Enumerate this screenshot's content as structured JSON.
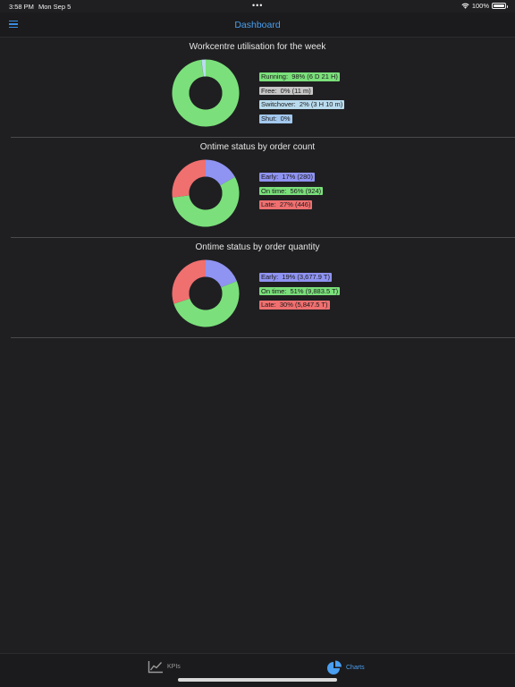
{
  "status_bar": {
    "time": "3:58 PM",
    "date": "Mon Sep 5",
    "dots": "•••",
    "battery": "100%"
  },
  "nav": {
    "title": "Dashboard",
    "accent_color": "#4a9ff0"
  },
  "chart_data": [
    {
      "type": "pie",
      "donut": true,
      "title": "Workcentre utilisation for the week",
      "legend_position": "right",
      "slices": [
        {
          "label": "Running:  98% (6 D 21 H)",
          "value": 98,
          "color": "#7be07b"
        },
        {
          "label": "Free:  0% (11 m)",
          "value": 0.1,
          "color": "#c7c7c7"
        },
        {
          "label": "Switchover:  2% (3 H 10 m)",
          "value": 2,
          "color": "#b9dcee"
        },
        {
          "label": "Shut:  0%",
          "value": 0,
          "color": "#a3c8ee"
        }
      ]
    },
    {
      "type": "pie",
      "donut": true,
      "title": "Ontime status by order count",
      "legend_position": "right",
      "slices": [
        {
          "label": "Early:  17% (280)",
          "value": 17,
          "color": "#8f93f2"
        },
        {
          "label": "On time:  56% (924)",
          "value": 56,
          "color": "#7be07b"
        },
        {
          "label": "Late:  27% (446)",
          "value": 27,
          "color": "#f06f6f"
        }
      ]
    },
    {
      "type": "pie",
      "donut": true,
      "title": "Ontime status by order quantity",
      "legend_position": "right",
      "slices": [
        {
          "label": "Early:  19% (3,677.9 T)",
          "value": 19,
          "color": "#8f93f2"
        },
        {
          "label": "On time:  51% (9,883.5 T)",
          "value": 51,
          "color": "#7be07b"
        },
        {
          "label": "Late:  30% (5,847.5 T)",
          "value": 30,
          "color": "#f06f6f"
        }
      ]
    }
  ],
  "tabs": [
    {
      "label": "KPIs",
      "icon": "line-chart-icon",
      "selected": false
    },
    {
      "label": "Charts",
      "icon": "pie-chart-icon",
      "selected": true
    }
  ]
}
